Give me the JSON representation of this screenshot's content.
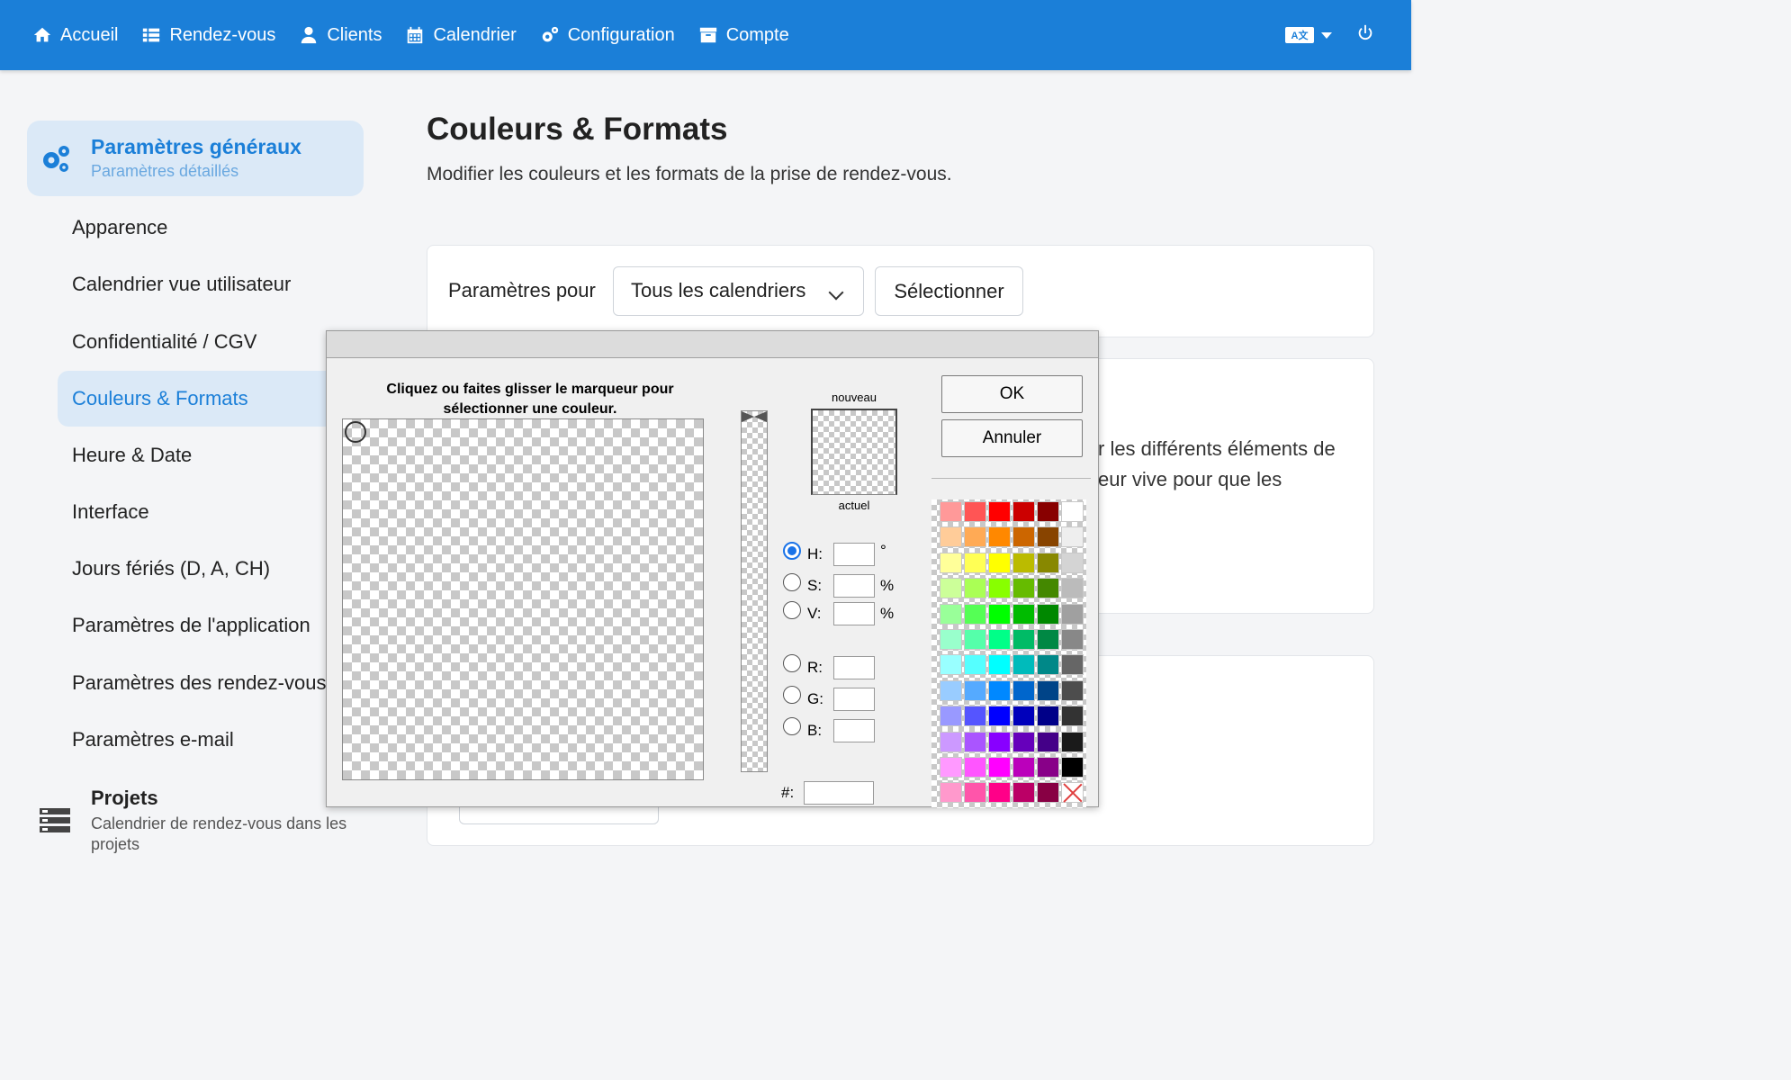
{
  "nav": {
    "items": [
      {
        "label": "Accueil",
        "icon": "home-icon"
      },
      {
        "label": "Rendez-vous",
        "icon": "list-icon"
      },
      {
        "label": "Clients",
        "icon": "user-icon"
      },
      {
        "label": "Calendrier",
        "icon": "calendar-icon"
      },
      {
        "label": "Configuration",
        "icon": "cogs-icon"
      },
      {
        "label": "Compte",
        "icon": "archive-icon"
      }
    ],
    "language_icon": "translate-icon",
    "power_icon": "power-icon"
  },
  "sidebar": {
    "header_title": "Paramètres généraux",
    "header_subtitle": "Paramètres détaillés",
    "items": [
      "Apparence",
      "Calendrier vue utilisateur",
      "Confidentialité / CGV",
      "Couleurs & Formats",
      "Heure & Date",
      "Interface",
      "Jours fériés (D, A, CH)",
      "Paramètres de l'application",
      "Paramètres des rendez-vous",
      "Paramètres e-mail"
    ],
    "active_index": 3,
    "projects_title": "Projets",
    "projects_subtitle": "Calendrier de rendez-vous dans les projets"
  },
  "main": {
    "title": "Couleurs & Formats",
    "description": "Modifier les couleurs et les formats de la prise de rendez-vous.",
    "params_label": "Paramètres pour",
    "calendar_select": "Tous les calendriers",
    "select_button": "Sélectionner",
    "card2_line1": "r les différents éléments de",
    "card2_line2": "eur vive pour que les"
  },
  "color_picker": {
    "instruction": "Cliquez ou faites glisser le marqueur pour sélectionner une couleur.",
    "label_new": "nouveau",
    "label_current": "actuel",
    "ok_label": "OK",
    "cancel_label": "Annuler",
    "fields": {
      "h_label": "H:",
      "h_unit": "°",
      "h_value": "",
      "s_label": "S:",
      "s_unit": "%",
      "s_value": "",
      "v_label": "V:",
      "v_unit": "%",
      "v_value": "",
      "r_label": "R:",
      "r_value": "",
      "g_label": "G:",
      "g_value": "",
      "b_label": "B:",
      "b_value": "",
      "hex_label": "#:",
      "hex_value": ""
    },
    "selected_mode": "H",
    "palette_rows": [
      [
        "#ff9999",
        "#ff5555",
        "#ff0000",
        "#cc0000",
        "#880000",
        "#ffffff"
      ],
      [
        "#ffcc99",
        "#ffaa55",
        "#ff8800",
        "#cc6600",
        "#884400",
        "#eeeeee"
      ],
      [
        "#ffff99",
        "#ffff55",
        "#ffff00",
        "#bbbb00",
        "#888800",
        "#d4d4d4"
      ],
      [
        "#ccff99",
        "#aaff55",
        "#88ff00",
        "#66bb00",
        "#448800",
        "#bbbbbb"
      ],
      [
        "#99ff99",
        "#55ff55",
        "#00ff00",
        "#00bb00",
        "#008800",
        "#a0a0a0"
      ],
      [
        "#99ffcc",
        "#55ffaa",
        "#00ff88",
        "#00bb66",
        "#008844",
        "#888888"
      ],
      [
        "#99ffff",
        "#55ffff",
        "#00ffff",
        "#00bbbb",
        "#008888",
        "#666666"
      ],
      [
        "#99ccff",
        "#55aaff",
        "#0088ff",
        "#0066cc",
        "#004488",
        "#4d4d4d"
      ],
      [
        "#9999ff",
        "#5555ff",
        "#0000ff",
        "#0000bb",
        "#000088",
        "#333333"
      ],
      [
        "#cc99ff",
        "#aa55ff",
        "#8800ff",
        "#6600bb",
        "#440088",
        "#1a1a1a"
      ],
      [
        "#ff99ff",
        "#ff55ff",
        "#ff00ff",
        "#bb00bb",
        "#880088",
        "#000000"
      ],
      [
        "#ff99cc",
        "#ff55aa",
        "#ff0088",
        "#bb0066",
        "#880044",
        "none"
      ]
    ]
  },
  "colors": {
    "brand": "#1b7fd8",
    "sidebar_active_bg": "#dbe9f7"
  }
}
